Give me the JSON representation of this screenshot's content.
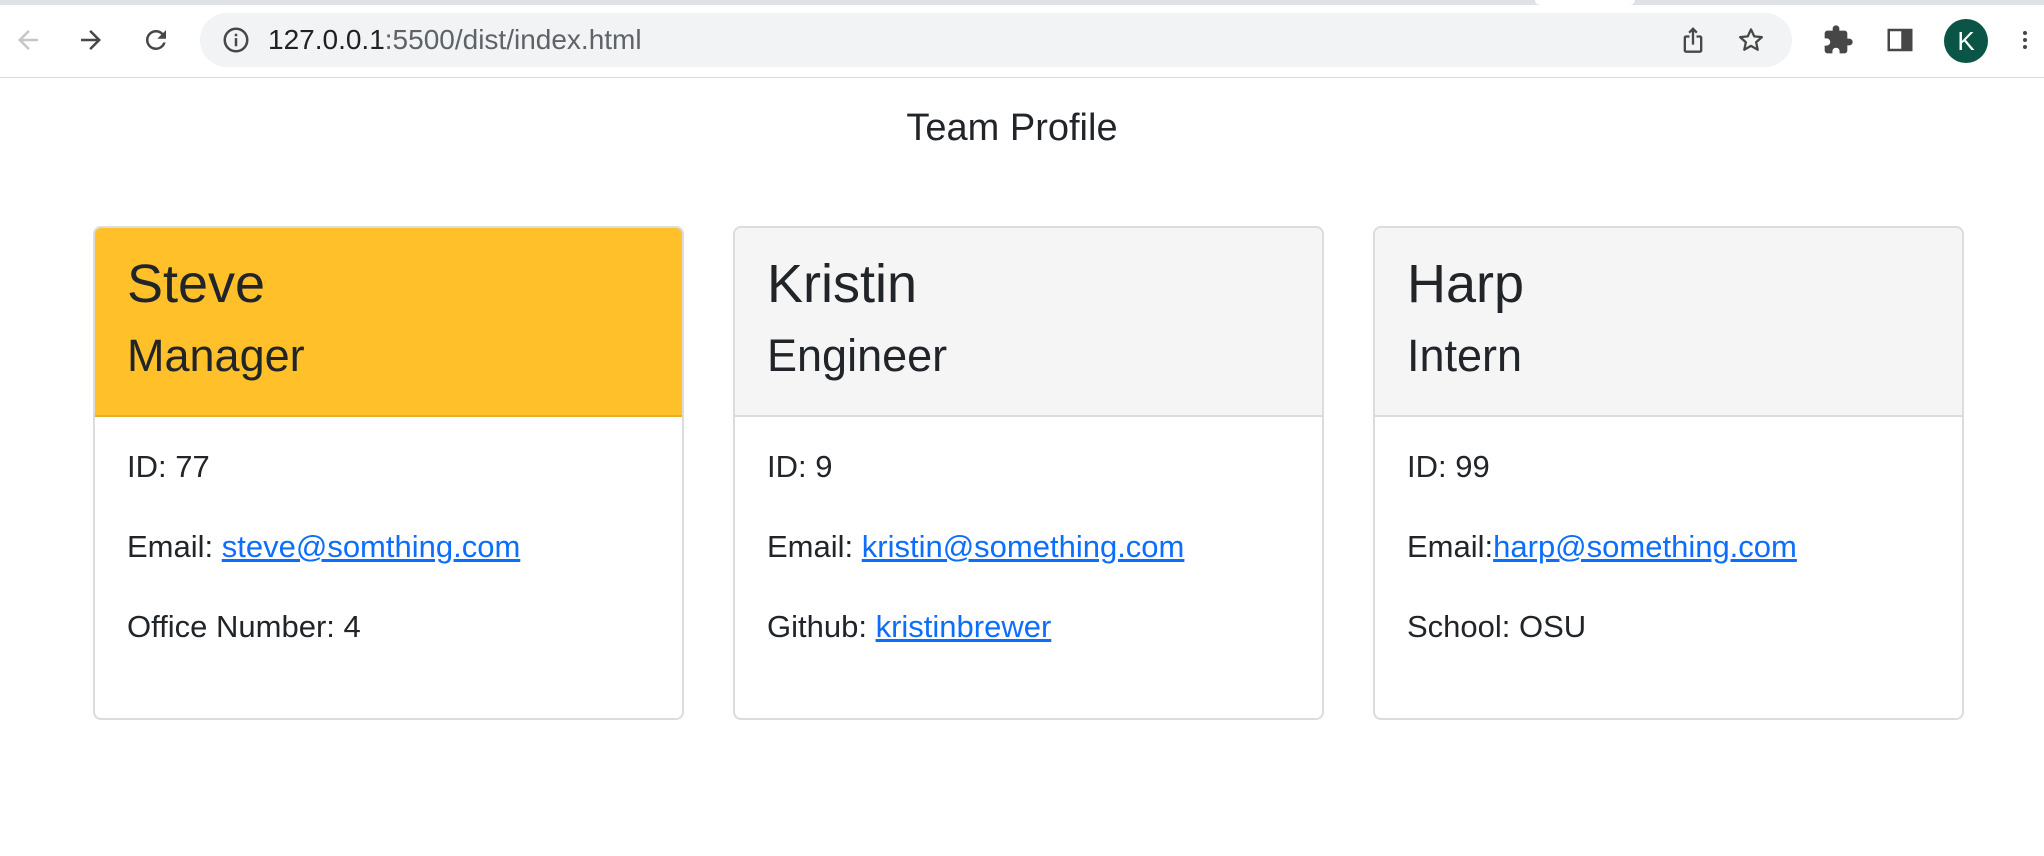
{
  "browser": {
    "url_host": "127.0.0.1",
    "url_rest": ":5500/dist/index.html",
    "profile_initial": "K"
  },
  "page": {
    "title": "Team Profile"
  },
  "cards": [
    {
      "name": "Steve",
      "role": "Manager",
      "id_label": "ID: 77",
      "email_label": "Email: ",
      "email": "steve@somthing.com",
      "extra_label": "Office Number: 4",
      "extra_link": ""
    },
    {
      "name": "Kristin",
      "role": "Engineer",
      "id_label": "ID: 9",
      "email_label": "Email: ",
      "email": "kristin@something.com",
      "extra_label": "Github: ",
      "extra_link": "kristinbrewer"
    },
    {
      "name": "Harp",
      "role": "Intern",
      "id_label": "ID: 99",
      "email_label": "Email:",
      "email": "harp@something.com",
      "extra_label": "School: OSU",
      "extra_link": ""
    }
  ],
  "colors": {
    "manager_header": "#ffc02a",
    "default_header": "#f5f5f5",
    "link": "#0d6efd",
    "avatar": "#0b5546"
  },
  "icons": [
    "back-icon",
    "forward-icon",
    "reload-icon",
    "info-icon",
    "share-icon",
    "star-icon",
    "extensions-icon",
    "side-panel-icon",
    "menu-icon"
  ]
}
